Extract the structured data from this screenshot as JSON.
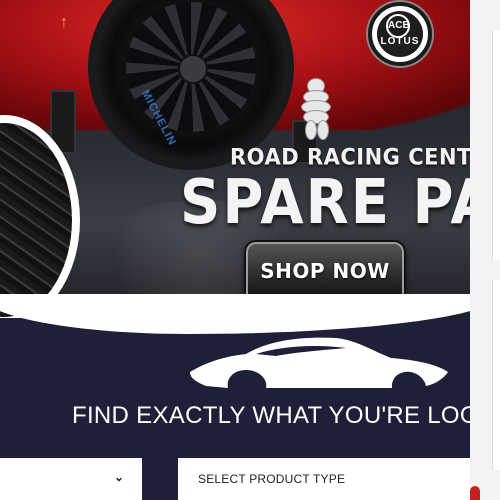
{
  "hero": {
    "subtitle": "ROAD RACING CENTER",
    "title": "SPARE PARTS",
    "cta_label": "SHOP NOW",
    "badge_brand": "LOTUS",
    "tyre_brand": "MICHELIN"
  },
  "finder": {
    "heading": "FIND EXACTLY WHAT YOU'RE LOOK",
    "left_select_value": "",
    "right_select_value": "SELECT PRODUCT TYPE"
  },
  "colors": {
    "navy": "#1d2038",
    "car_red": "#c0171b",
    "white": "#ffffff"
  },
  "icons": {
    "chevron": "chevron-down-icon",
    "car": "sports-car-silhouette-icon",
    "badge": "lotus-logo-icon"
  }
}
